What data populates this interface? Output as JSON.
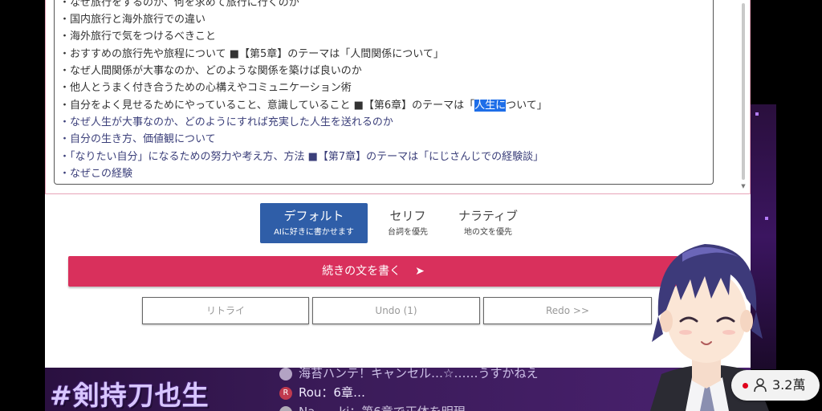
{
  "editor": {
    "lines": [
      {
        "text": "・なぜ旅行をするのか、何を求めて旅行に行くのか"
      },
      {
        "text": "・国内旅行と海外旅行での違い"
      },
      {
        "text": "・海外旅行で気をつけるべきこと"
      },
      {
        "text": "・おすすめの旅行先や旅程について ■【第5章】のテーマは「人間関係について」"
      },
      {
        "text": "・なぜ人間関係が大事なのか、どのような関係を築けば良いのか"
      },
      {
        "text": "・他人とうまく付き合うための心構えやコミュニケーション術"
      },
      {
        "pre": "・自分をよく見せるためにやっていること、意識していること ■【第6章】のテーマは「",
        "highlight": "人生に",
        "post": "ついて」"
      },
      {
        "text": "・なぜ人生が大事なのか、どのようにすれば充実した人生を送れるのか"
      },
      {
        "text": "・自分の生き方、価値観について"
      },
      {
        "text": "・「なりたい自分」になるための努力や考え方、方法 ■【第7章】のテーマは「にじさんじでの経験談」"
      },
      {
        "text": "・なぜこの経験"
      }
    ]
  },
  "modes": {
    "default": {
      "title": "デフォルト",
      "sub": "AIに好きに書かせます"
    },
    "serif": {
      "title": "セリフ",
      "sub": "台詞を優先"
    },
    "narrative": {
      "title": "ナラティブ",
      "sub": "地の文を優先"
    }
  },
  "actions": {
    "continue_label": "続きの文を書く",
    "continue_arrow": "➤",
    "retry_label": "リトライ",
    "undo_label": "Undo (1)",
    "redo_label": "Redo >>"
  },
  "stream": {
    "hashtag": "#剣持刀也生",
    "chat": [
      {
        "avatar": "",
        "text": "海苔ハンテ！キャンセル…☆……うすかねえ"
      },
      {
        "avatar": "R",
        "text": "Rou：6章…"
      },
      {
        "avatar": "",
        "text": "Na……ki：第6章で正体を明現"
      }
    ],
    "viewer_count": "3.2萬"
  },
  "colors": {
    "accent_red": "#d9305c",
    "mode_blue": "#2f5ea8",
    "highlight_blue": "#1e6ee8",
    "live_dot": "#e0001b"
  },
  "icons": [
    "arrow-right-icon",
    "person-icon",
    "live-dot-icon"
  ]
}
